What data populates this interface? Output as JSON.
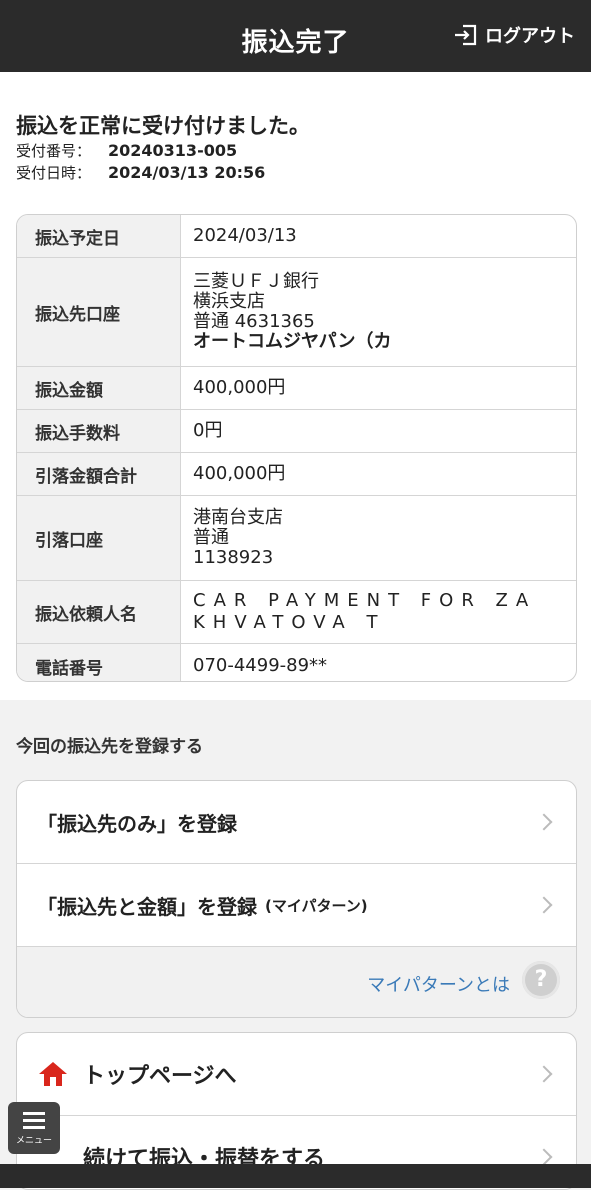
{
  "header": {
    "title": "振込完了",
    "logout_label": "ログアウト"
  },
  "result": {
    "message": "振込を正常に受け付けました。",
    "receipt_number_label": "受付番号：",
    "receipt_number": "20240313-005",
    "receipt_datetime_label": "受付日時：",
    "receipt_datetime": "2024/03/13 20:56"
  },
  "details": {
    "scheduled_date_label": "振込予定日",
    "scheduled_date": "2024/03/13",
    "dest_label": "振込先口座",
    "dest_bank": "三菱ＵＦＪ銀行",
    "dest_branch": "横浜支店",
    "dest_account": "普通 4631365",
    "dest_name": "オートコムジヤパン（カ",
    "amount_label": "振込金額",
    "amount": "400,000円",
    "fee_label": "振込手数料",
    "fee": "0円",
    "total_label": "引落金額合計",
    "total": "400,000円",
    "debit_label": "引落口座",
    "debit_branch": "港南台支店",
    "debit_type": "普通",
    "debit_number": "1138923",
    "requester_label": "振込依頼人名",
    "requester_line1": "CAR PAYMENT FOR ZA",
    "requester_line2": "KHVATOVA T",
    "phone_label": "電話番号",
    "phone": "070-4499-89**"
  },
  "register": {
    "section_title": "今回の振込先を登録する",
    "option1": "「振込先のみ」を登録",
    "option2": "「振込先と金額」を登録",
    "option2_note": "(マイパターン)",
    "mypattern_link": "マイパターンとは",
    "help_symbol": "?"
  },
  "nav": {
    "top_page": "トップページへ",
    "continue_transfer": "続けて振込・振替をする"
  },
  "menu": {
    "label": "メニュー"
  }
}
